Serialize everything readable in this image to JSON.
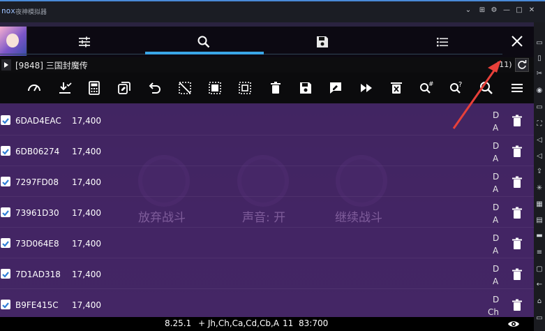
{
  "window": {
    "logo": "nox",
    "title": "夜神模拟器",
    "controls": [
      "⌄",
      "⊞",
      "⚙",
      "—",
      "□",
      "✕"
    ]
  },
  "game_overlay": {
    "buttons": [
      "放弃战斗",
      "声音: 开",
      "继续战斗"
    ]
  },
  "gg": {
    "tabs": [
      {
        "name": "settings-sliders-icon"
      },
      {
        "name": "search-icon",
        "active": true
      },
      {
        "name": "save-icon"
      },
      {
        "name": "list-icon"
      }
    ],
    "process": {
      "label": "[9848] 三国封魔传",
      "count": "(11)"
    },
    "toolbar": [
      "speedometer-icon",
      "download-check-icon",
      "calculator-icon",
      "copy-edit-icon",
      "undo-icon",
      "select-none-icon",
      "select-all-icon",
      "select-inverse-icon",
      "delete-icon",
      "save-icon",
      "edit-icon",
      "fast-forward-icon",
      "clear-icon",
      "search-hex-icon",
      "search-unknown-icon",
      "search-icon",
      "menu-icon"
    ],
    "results": [
      {
        "address": "6DAD4EAC",
        "value": "17,400",
        "type1": "D",
        "type2": "A"
      },
      {
        "address": "6DB06274",
        "value": "17,400",
        "type1": "D",
        "type2": "A"
      },
      {
        "address": "7297FD08",
        "value": "17,400",
        "type1": "D",
        "type2": "A"
      },
      {
        "address": "73961D30",
        "value": "17,400",
        "type1": "D",
        "type2": "A"
      },
      {
        "address": "73D064E8",
        "value": "17,400",
        "type1": "D",
        "type2": "A"
      },
      {
        "address": "7D1AD318",
        "value": "17,400",
        "type1": "D",
        "type2": "A"
      },
      {
        "address": "B9FE415C",
        "value": "17,400",
        "type1": "D",
        "type2": "Ch"
      }
    ],
    "status": {
      "version": "8.25.1",
      "regions": "+ Jh,Ch,Ca,Cd,Cb,A",
      "count": "11",
      "ratio": "83:700"
    }
  },
  "colors": {
    "accent": "#3aa6e6",
    "annotation_arrow": "#e8403a",
    "checkbox": "#2f7fd6"
  }
}
